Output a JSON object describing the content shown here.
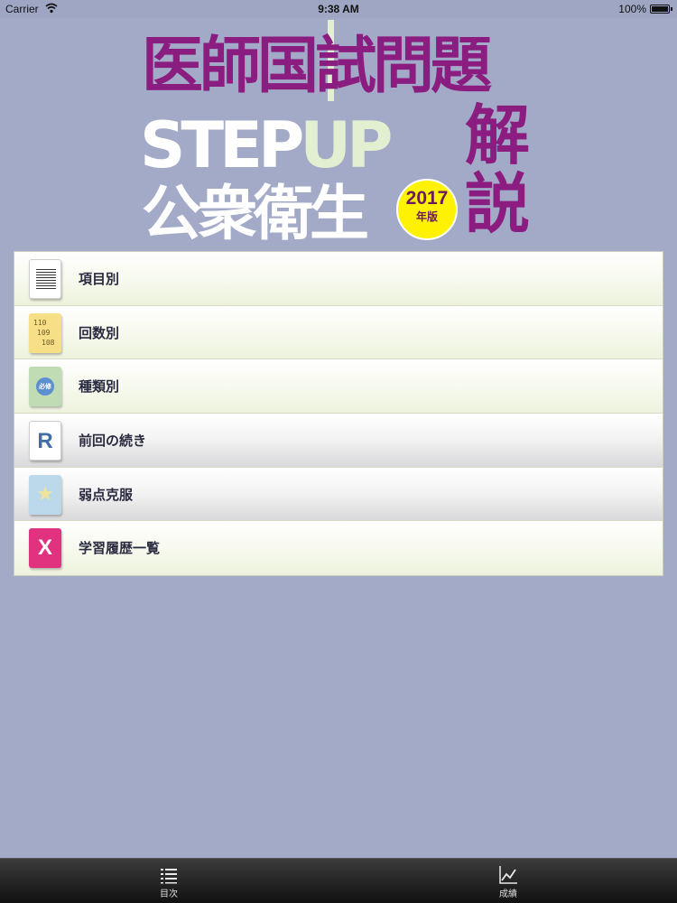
{
  "status_bar": {
    "carrier": "Carrier",
    "time": "9:38 AM",
    "battery": "100%"
  },
  "logo": {
    "title_line1": "医師国試問題",
    "title_step": "STEP",
    "title_up": "UP",
    "title_line3": "公衆衛生",
    "title_kai": "解",
    "title_setsu": "説",
    "badge_year": "2017",
    "badge_edition": "年版",
    "colors": {
      "purple": "#8a1d7f",
      "badge_yellow": "#fff200"
    }
  },
  "menu": {
    "items": [
      {
        "label": "項目別",
        "icon": "document-lines-icon",
        "style": "green"
      },
      {
        "label": "回数別",
        "icon": "sticky-note-icon",
        "style": "green",
        "note_lines": [
          "110",
          "109",
          "108"
        ]
      },
      {
        "label": "種類別",
        "icon": "category-flag-icon",
        "style": "green",
        "badge": "必修"
      },
      {
        "label": "前回の続き",
        "icon": "resume-r-icon",
        "style": "gray",
        "glyph": "R"
      },
      {
        "label": "弱点克服",
        "icon": "star-flag-icon",
        "style": "gray"
      },
      {
        "label": "学習履歴一覧",
        "icon": "history-x-icon",
        "style": "green",
        "glyph": "X"
      }
    ]
  },
  "tab_bar": {
    "tabs": [
      {
        "label": "目次",
        "icon": "list-icon"
      },
      {
        "label": "成績",
        "icon": "chart-icon"
      }
    ]
  }
}
